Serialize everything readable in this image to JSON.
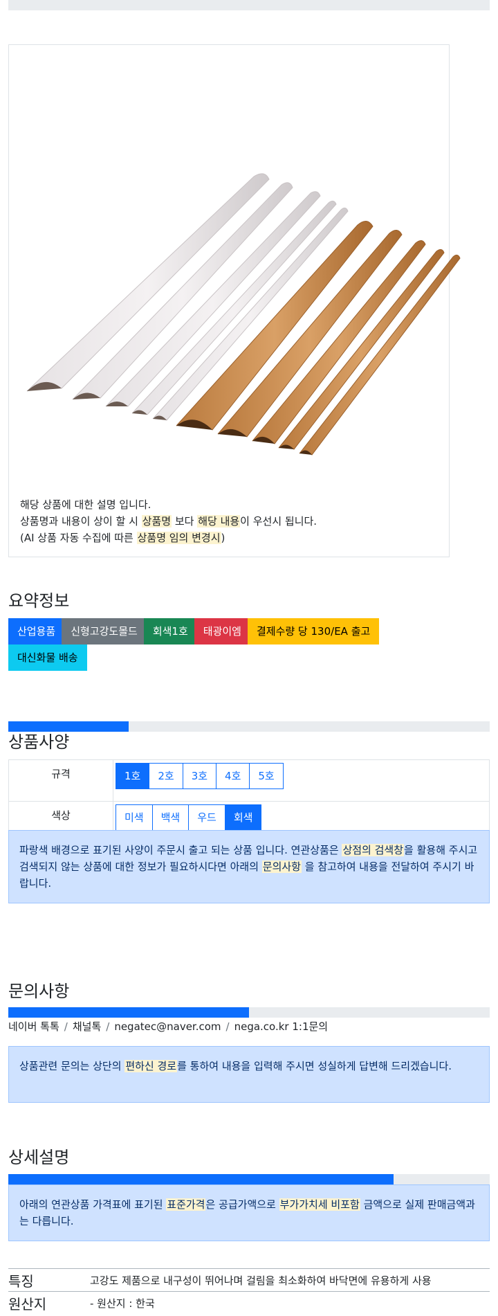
{
  "product": {
    "image_alt": "몰드 제품 이미지",
    "description": {
      "line1": "해당 상품에 대한 설명 입니다.",
      "line2_a": "상품명과 내용이 상이 할 시 ",
      "line2_mark1": "상품명",
      "line2_b": " 보다 ",
      "line2_mark2": "해당 내용",
      "line2_c": "이 우선시 됩니다.",
      "line3_a": "(AI 상품 자동 수집에 따른 ",
      "line3_mark": "상품명 임의 변경시",
      "line3_b": ")"
    }
  },
  "summary": {
    "title": "요약정보",
    "badges": [
      {
        "label": "산업용품",
        "color": "#0d6efd",
        "text_color": "#ffffff"
      },
      {
        "label": "신형고강도몰드",
        "color": "#6c757d",
        "text_color": "#ffffff"
      },
      {
        "label": "회색1호",
        "color": "#198754",
        "text_color": "#ffffff"
      },
      {
        "label": "태광이엠",
        "color": "#dc3545",
        "text_color": "#ffffff"
      },
      {
        "label": "결제수량 당 130/EA 출고",
        "color": "#ffc107",
        "text_color": "#000000"
      },
      {
        "label": "대신화물 배송",
        "color": "#0dcaf0",
        "text_color": "#000000"
      }
    ]
  },
  "spec": {
    "title": "상품사양",
    "progress": 0.25,
    "size_label": "규격",
    "sizes": [
      "1호",
      "2호",
      "3호",
      "4호",
      "5호"
    ],
    "size_selected": 0,
    "color_label": "색상",
    "colors": [
      "미색",
      "백색",
      "우드",
      "회색"
    ],
    "color_selected": 3,
    "notice": {
      "a": "파랑색 배경으로 표기된 사양이 주문시 출고 되는 상품 입니다. 연관상품은 ",
      "mark1": "상점의 검색창",
      "b": "을 활용해 주시고 검색되지 않는 상품에 대한 정보가 필요하시다면 아래의 ",
      "mark2": "문의사항",
      "c": " 을 참고하여 내용을 전달하여 주시기 바랍니다."
    }
  },
  "inquiry": {
    "title": "문의사항",
    "progress": 0.5,
    "contacts": [
      "네이버 톡톡",
      "채널톡",
      "negatec@naver.com",
      "nega.co.kr 1:1문의"
    ],
    "notice": {
      "a": "상품관련 문의는 상단의 ",
      "mark": "편하신 경로",
      "b": "를 통하여 내용을 입력해 주시면 성실하게 답변해 드리겠습니다."
    }
  },
  "detail": {
    "title": "상세설명",
    "progress": 0.8,
    "notice": {
      "a": "아래의 연관상품 가격표에 표기된 ",
      "mark1": "표준가격",
      "b": "은 공급가액으로 ",
      "mark2": "부가가치세 비포함",
      "c": " 금액으로 실제 판매금액과는 다릅니다."
    },
    "features": [
      {
        "key": "특징",
        "value": "고강도 제품으로 내구성이 뛰어나며 걸림을 최소화하여 바닥면에 유용하게 사용"
      },
      {
        "key": "원산지",
        "value": "- 원산지 : 한국"
      }
    ]
  },
  "colors": {
    "primary": "#0d6efd",
    "alert_bg": "#cfe2ff",
    "alert_text": "#052c65",
    "mark_bg": "#fcf3cf",
    "track": "#e9ecef"
  }
}
